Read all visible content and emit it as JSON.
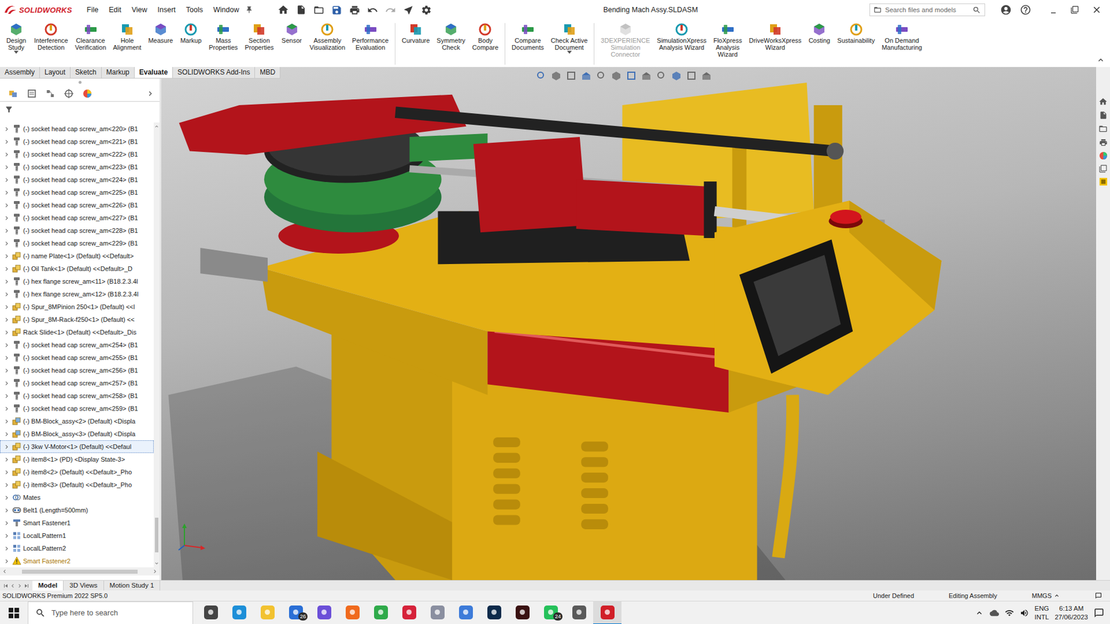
{
  "app": {
    "logo": "SOLIDWORKS",
    "menus": [
      "File",
      "Edit",
      "View",
      "Insert",
      "Tools",
      "Window"
    ],
    "title": "Bending Mach Assy.SLDASM",
    "search_placeholder": "Search files and models"
  },
  "ribbon": {
    "groups": [
      [
        {
          "lines": [
            "Design",
            "Study"
          ],
          "dropdown": true,
          "disabled": false
        },
        {
          "lines": [
            "Interference",
            "Detection"
          ],
          "dropdown": false,
          "disabled": false
        },
        {
          "lines": [
            "Clearance",
            "Verification"
          ],
          "dropdown": false,
          "disabled": false
        },
        {
          "lines": [
            "Hole",
            "Alignment"
          ],
          "dropdown": false,
          "disabled": false
        },
        {
          "lines": [
            "Measure"
          ],
          "dropdown": false,
          "disabled": false
        },
        {
          "lines": [
            "Markup"
          ],
          "dropdown": false,
          "disabled": false
        },
        {
          "lines": [
            "Mass",
            "Properties"
          ],
          "dropdown": false,
          "disabled": false
        },
        {
          "lines": [
            "Section",
            "Properties"
          ],
          "dropdown": false,
          "disabled": false
        },
        {
          "lines": [
            "Sensor"
          ],
          "dropdown": false,
          "disabled": false
        },
        {
          "lines": [
            "Assembly",
            "Visualization"
          ],
          "dropdown": false,
          "disabled": false
        },
        {
          "lines": [
            "Performance",
            "Evaluation"
          ],
          "dropdown": false,
          "disabled": false
        }
      ],
      [
        {
          "lines": [
            "Curvature"
          ],
          "dropdown": false,
          "disabled": false
        },
        {
          "lines": [
            "Symmetry",
            "Check"
          ],
          "dropdown": false,
          "disabled": false
        },
        {
          "lines": [
            "Body",
            "Compare"
          ],
          "dropdown": false,
          "disabled": false
        }
      ],
      [
        {
          "lines": [
            "Compare",
            "Documents"
          ],
          "dropdown": false,
          "disabled": false
        },
        {
          "lines": [
            "Check Active",
            "Document"
          ],
          "dropdown": true,
          "disabled": false
        }
      ],
      [
        {
          "lines": [
            "3DEXPERIENCE",
            "Simulation",
            "Connector"
          ],
          "dropdown": false,
          "disabled": true
        },
        {
          "lines": [
            "SimulationXpress",
            "Analysis Wizard"
          ],
          "dropdown": false,
          "disabled": false
        },
        {
          "lines": [
            "FloXpress",
            "Analysis",
            "Wizard"
          ],
          "dropdown": false,
          "disabled": false
        },
        {
          "lines": [
            "DriveWorksXpress",
            "Wizard"
          ],
          "dropdown": false,
          "disabled": false
        },
        {
          "lines": [
            "Costing"
          ],
          "dropdown": false,
          "disabled": false
        },
        {
          "lines": [
            "Sustainability"
          ],
          "dropdown": false,
          "disabled": false
        },
        {
          "lines": [
            "On Demand",
            "Manufacturing"
          ],
          "dropdown": false,
          "disabled": false
        }
      ]
    ]
  },
  "tabs": [
    {
      "label": "Assembly",
      "selected": false
    },
    {
      "label": "Layout",
      "selected": false
    },
    {
      "label": "Sketch",
      "selected": false
    },
    {
      "label": "Markup",
      "selected": false
    },
    {
      "label": "Evaluate",
      "selected": true
    },
    {
      "label": "SOLIDWORKS Add-Ins",
      "selected": false
    },
    {
      "label": "MBD",
      "selected": false
    }
  ],
  "tree": {
    "items": [
      {
        "label": "(-) socket head cap screw_am<220> (B1",
        "kind": "part",
        "selected": false
      },
      {
        "label": "(-) socket head cap screw_am<221> (B1",
        "kind": "part",
        "selected": false
      },
      {
        "label": "(-) socket head cap screw_am<222> (B1",
        "kind": "part",
        "selected": false
      },
      {
        "label": "(-) socket head cap screw_am<223> (B1",
        "kind": "part",
        "selected": false
      },
      {
        "label": "(-) socket head cap screw_am<224> (B1",
        "kind": "part",
        "selected": false
      },
      {
        "label": "(-) socket head cap screw_am<225> (B1",
        "kind": "part",
        "selected": false
      },
      {
        "label": "(-) socket head cap screw_am<226> (B1",
        "kind": "part",
        "selected": false
      },
      {
        "label": "(-) socket head cap screw_am<227> (B1",
        "kind": "part",
        "selected": false
      },
      {
        "label": "(-) socket head cap screw_am<228> (B1",
        "kind": "part",
        "selected": false
      },
      {
        "label": "(-) socket head cap screw_am<229> (B1",
        "kind": "part",
        "selected": false
      },
      {
        "label": "(-) name Plate<1> (Default) <<Default>",
        "kind": "assembly",
        "selected": false
      },
      {
        "label": "(-) Oil Tank<1> (Default) <<Default>_D",
        "kind": "assembly",
        "selected": false
      },
      {
        "label": "(-) hex flange screw_am<11> (B18.2.3.4l",
        "kind": "part",
        "selected": false
      },
      {
        "label": "(-) hex flange screw_am<12> (B18.2.3.4l",
        "kind": "part",
        "selected": false
      },
      {
        "label": "(-) Spur_8MPinion 250<1> (Default) <<l",
        "kind": "assembly",
        "selected": false
      },
      {
        "label": "(-) Spur_8M-Rack-f250<1> (Default) <<",
        "kind": "assembly",
        "selected": false
      },
      {
        "label": "Rack Slide<1> (Default) <<Default>_Dis",
        "kind": "assembly",
        "selected": false
      },
      {
        "label": "(-) socket head cap screw_am<254> (B1",
        "kind": "part",
        "selected": false
      },
      {
        "label": "(-) socket head cap screw_am<255> (B1",
        "kind": "part",
        "selected": false
      },
      {
        "label": "(-) socket head cap screw_am<256> (B1",
        "kind": "part",
        "selected": false
      },
      {
        "label": "(-) socket head cap screw_am<257> (B1",
        "kind": "part",
        "selected": false
      },
      {
        "label": "(-) socket head cap screw_am<258> (B1",
        "kind": "part",
        "selected": false
      },
      {
        "label": "(-) socket head cap screw_am<259> (B1",
        "kind": "part",
        "selected": false
      },
      {
        "label": "(-) BM-Block_assy<2> (Default) <Displa",
        "kind": "subassembly",
        "selected": false
      },
      {
        "label": "(-) BM-Block_assy<3> (Default) <Displa",
        "kind": "subassembly",
        "selected": false
      },
      {
        "label": "(-) 3kw V-Motor<1> (Default) <<Defaul",
        "kind": "assembly",
        "selected": true
      },
      {
        "label": "(-) item8<1> (PD) <Display State-3>",
        "kind": "assembly",
        "selected": false
      },
      {
        "label": "(-) item8<2> (Default) <<Default>_Pho",
        "kind": "assembly",
        "selected": false
      },
      {
        "label": "(-) item8<3> (Default) <<Default>_Pho",
        "kind": "assembly",
        "selected": false
      },
      {
        "label": "Mates",
        "kind": "mates",
        "selected": false
      },
      {
        "label": "Belt1 (Length=500mm)",
        "kind": "belt",
        "selected": false
      },
      {
        "label": "Smart Fastener1",
        "kind": "fastener",
        "selected": false
      },
      {
        "label": "LocalLPattern1",
        "kind": "pattern",
        "selected": false
      },
      {
        "label": "LocalLPattern2",
        "kind": "pattern",
        "selected": false
      },
      {
        "label": "Smart Fastener2",
        "kind": "warning",
        "selected": false
      }
    ]
  },
  "bottom_tabs": [
    {
      "label": "Model",
      "selected": true
    },
    {
      "label": "3D Views",
      "selected": false
    },
    {
      "label": "Motion Study 1",
      "selected": false
    }
  ],
  "status_bar": {
    "version": "SOLIDWORKS Premium 2022 SP5.0",
    "state": "Under Defined",
    "mode": "Editing Assembly",
    "units": "MMGS"
  },
  "taskbar": {
    "search_placeholder": "Type here to search",
    "apps": [
      {
        "color": "#444444",
        "selected": false
      },
      {
        "color": "#1d8fd8",
        "selected": false
      },
      {
        "color": "#f2c230",
        "selected": false
      },
      {
        "color": "#2a6fd6",
        "selected": false,
        "badge": "26"
      },
      {
        "color": "#6b4fd8",
        "selected": false
      },
      {
        "color": "#f06a1d",
        "selected": false
      },
      {
        "color": "#2faa4a",
        "selected": false
      },
      {
        "color": "#d6223a",
        "selected": false
      },
      {
        "color": "#8a8fa0",
        "selected": false
      },
      {
        "color": "#3d7bd9",
        "selected": false
      },
      {
        "color": "#0d2a4a",
        "selected": false
      },
      {
        "color": "#3a1212",
        "selected": false
      },
      {
        "color": "#25c15a",
        "selected": false,
        "badge": "24"
      },
      {
        "color": "#5a5a5a",
        "selected": false
      },
      {
        "color": "#d11f28",
        "selected": true
      }
    ],
    "lang": "ENG",
    "layout": "INTL",
    "time": "6:13 AM",
    "date": "27/06/2023"
  }
}
